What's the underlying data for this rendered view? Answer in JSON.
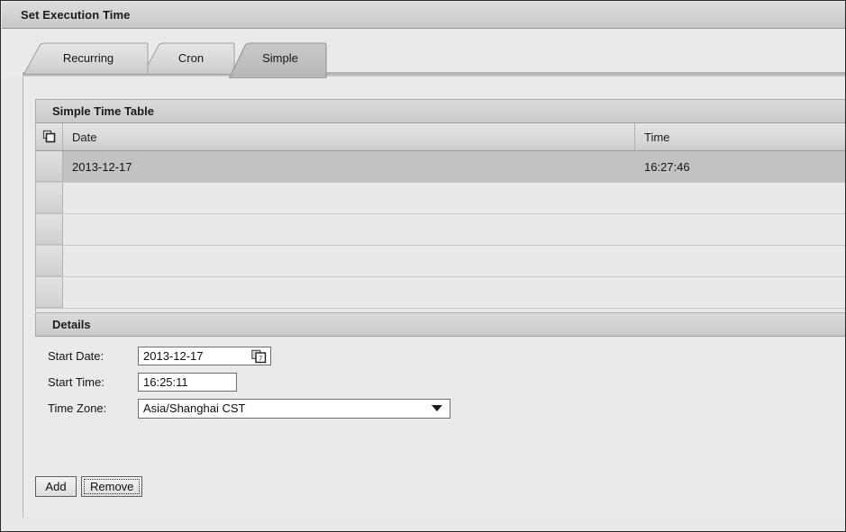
{
  "window": {
    "title": "Set Execution Time"
  },
  "tabs": [
    {
      "label": "Recurring",
      "selected": false,
      "name": "tab-recurring"
    },
    {
      "label": "Cron",
      "selected": false,
      "name": "tab-cron"
    },
    {
      "label": "Simple",
      "selected": true,
      "name": "tab-simple"
    }
  ],
  "table": {
    "title": "Simple Time Table",
    "corner_icon": "columns-select-icon",
    "columns": [
      "Date",
      "Time"
    ],
    "rows": [
      {
        "date": "2013-12-17",
        "time": "16:27:46",
        "selected": true
      },
      {
        "date": "",
        "time": "",
        "selected": false
      },
      {
        "date": "",
        "time": "",
        "selected": false
      },
      {
        "date": "",
        "time": "",
        "selected": false
      },
      {
        "date": "",
        "time": "",
        "selected": false
      }
    ]
  },
  "details": {
    "title": "Details",
    "fields": {
      "start_date": {
        "label": "Start Date:",
        "value": "2013-12-17",
        "icon": "calendar-picker-icon"
      },
      "start_time": {
        "label": "Start Time:",
        "value": "16:25:11"
      },
      "time_zone": {
        "label": "Time Zone:",
        "value": "Asia/Shanghai CST",
        "icon": "chevron-down-icon"
      }
    }
  },
  "buttons": {
    "add": "Add",
    "remove": "Remove"
  },
  "colors": {
    "window_border": "#2b2b2b",
    "panel_bg": "#e9e9e9",
    "header_bar": "#d3d3d3",
    "selected_row": "#c2c2c2",
    "field_bg": "#ffffff",
    "text": "#141414"
  }
}
